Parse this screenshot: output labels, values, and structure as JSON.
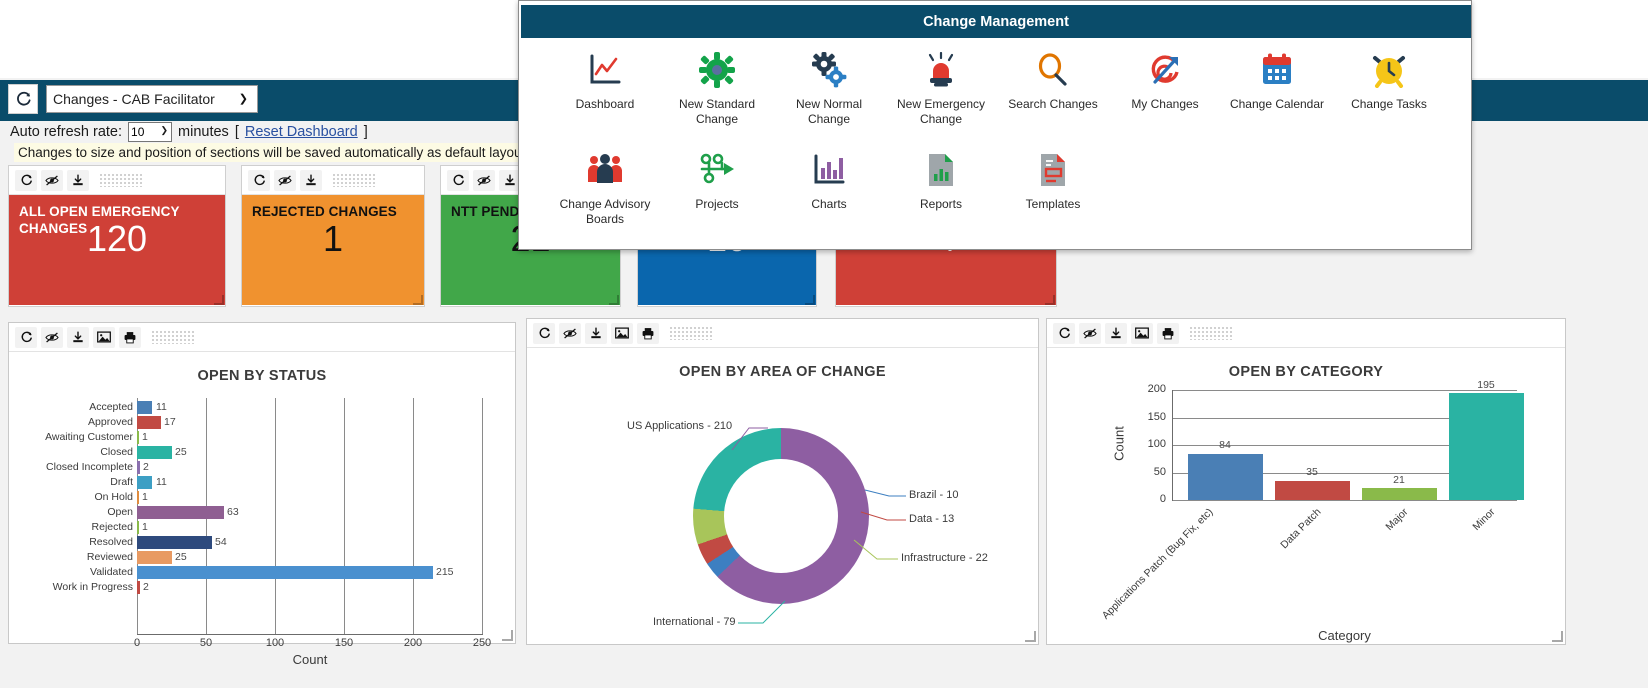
{
  "topbar": {
    "refresh_icon": "refresh-icon",
    "dashboard_select_value": "Changes - CAB Facilitator",
    "chevron": "⌄"
  },
  "refresh_rate": {
    "label": "Auto refresh rate:",
    "value": "10",
    "unit": "minutes",
    "bracket_open": "[",
    "reset_link": "Reset Dashboard",
    "bracket_close": "]"
  },
  "layout_note": "Changes to size and position of sections will be saved automatically as default layout",
  "widget_toolbar_icons": [
    "refresh-icon",
    "hide-icon",
    "download-icon",
    "image-icon",
    "print-icon",
    "drag-grip"
  ],
  "kpi_tiles": [
    {
      "title": "ALL OPEN EMERGENCY CHANGES",
      "value": "120",
      "bg": "#cf4037",
      "fg": "#ffffff"
    },
    {
      "title": "REJECTED CHANGES",
      "value": "1",
      "bg": "#f0922f",
      "fg": "#111111"
    },
    {
      "title": "NTT PENDING",
      "value": "21",
      "bg": "#41a749",
      "fg": "#111111"
    },
    {
      "title": "",
      "value": "10",
      "bg": "#0a66ad",
      "fg": "#ffffff"
    },
    {
      "title": "",
      "value": "4",
      "bg": "#cf4037",
      "fg": "#ffffff"
    }
  ],
  "flyout": {
    "header": "Change Management",
    "row1": [
      {
        "label": "Dashboard",
        "icon": "line-chart-icon"
      },
      {
        "label": "New Standard Change",
        "icon": "green-gear-icon"
      },
      {
        "label": "New Normal Change",
        "icon": "blue-gears-icon"
      },
      {
        "label": "New Emergency Change",
        "icon": "siren-icon"
      },
      {
        "label": "Search Changes",
        "icon": "magnifier-icon"
      },
      {
        "label": "My Changes",
        "icon": "target-arrow-icon"
      },
      {
        "label": "Change Calendar",
        "icon": "calendar-icon"
      },
      {
        "label": "Change Tasks",
        "icon": "alarm-clock-icon"
      }
    ],
    "row2": [
      {
        "label": "Change Advisory Boards",
        "icon": "people-group-icon"
      },
      {
        "label": "Projects",
        "icon": "workflow-arrow-icon"
      },
      {
        "label": "Charts",
        "icon": "bar-chart-icon"
      },
      {
        "label": "Reports",
        "icon": "report-doc-icon"
      },
      {
        "label": "Templates",
        "icon": "template-doc-icon"
      }
    ]
  },
  "chart_data": [
    {
      "type": "bar",
      "orientation": "horizontal",
      "title": "OPEN BY STATUS",
      "xlabel": "Count",
      "ylabel": "",
      "xlim": [
        0,
        250
      ],
      "xticks": [
        0,
        50,
        100,
        150,
        200,
        250
      ],
      "grid": true,
      "categories": [
        "Accepted",
        "Approved",
        "Awaiting Customer",
        "Closed",
        "Closed Incomplete",
        "Draft",
        "On Hold",
        "Open",
        "Rejected",
        "Resolved",
        "Reviewed",
        "Validated",
        "Work in Progress"
      ],
      "values": [
        11,
        17,
        1,
        25,
        2,
        11,
        1,
        63,
        1,
        54,
        25,
        215,
        2
      ],
      "colors": [
        "#4a7fb5",
        "#c14a43",
        "#8aba4a",
        "#2ab3a3",
        "#8a6fae",
        "#3d9fc4",
        "#e08c3e",
        "#8f5f92",
        "#8aba4a",
        "#2e4a7d",
        "#e89a62",
        "#4a90cf",
        "#c14a43"
      ]
    },
    {
      "type": "pie",
      "variant": "donut",
      "title": "OPEN BY AREA OF CHANGE",
      "labels": [
        "US Applications",
        "Brazil",
        "Data",
        "Infrastructure",
        "International"
      ],
      "values": [
        210,
        10,
        13,
        22,
        79
      ],
      "label_texts": [
        "US Applications - 210",
        "Brazil - 10",
        "Data - 13",
        "Infrastructure - 22",
        "International - 79"
      ],
      "colors": [
        "#8e5ea2",
        "#3d7fc1",
        "#c14a43",
        "#a8c martian",
        "#2ab3a3"
      ],
      "slice_colors": [
        "#8e5ea2",
        "#3d7fc1",
        "#c14a43",
        "#a8c55a",
        "#2ab3a3"
      ],
      "legend": "labeled-callouts"
    },
    {
      "type": "bar",
      "orientation": "vertical",
      "title": "OPEN BY CATEGORY",
      "xlabel": "Category",
      "ylabel": "Count",
      "ylim": [
        0,
        200
      ],
      "yticks": [
        0,
        50,
        100,
        150,
        200
      ],
      "grid": true,
      "categories": [
        "Applications Patch (Bug Fix, etc)",
        "Data Patch",
        "Major",
        "Minor"
      ],
      "values": [
        84,
        35,
        21,
        195
      ],
      "colors": [
        "#4a7fb5",
        "#c14a43",
        "#8aba4a",
        "#2ab3a3"
      ]
    }
  ]
}
